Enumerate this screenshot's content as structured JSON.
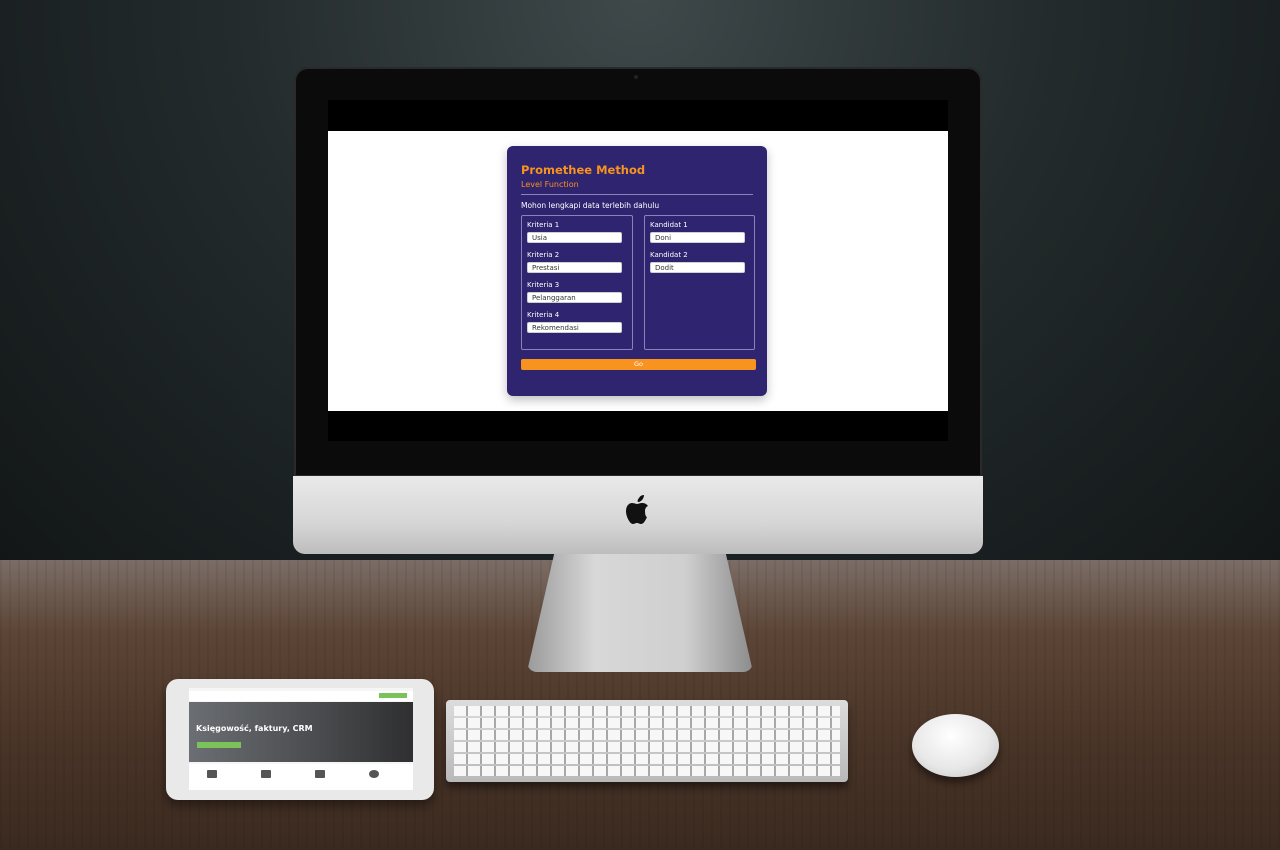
{
  "app": {
    "title": "Promethee Method",
    "subtitle": "Level Function",
    "instruction": "Mohon lengkapi data terlebih dahulu",
    "criteria": [
      {
        "label": "Kriteria 1",
        "value": "Usia"
      },
      {
        "label": "Kriteria 2",
        "value": "Prestasi"
      },
      {
        "label": "Kriteria 3",
        "value": "Pelanggaran"
      },
      {
        "label": "Kriteria 4",
        "value": "Rekomendasi"
      }
    ],
    "candidates": [
      {
        "label": "Kandidat 1",
        "value": "Doni"
      },
      {
        "label": "Kandidat 2",
        "value": "Dodit"
      }
    ],
    "go_label": "Go",
    "colors": {
      "card_background": "#2e2470",
      "accent": "#f7931e",
      "text": "#ffffff"
    }
  },
  "tablet": {
    "hero_text": "Księgowość, faktury, CRM"
  },
  "icons": {
    "device_logo": "apple-logo-icon"
  }
}
